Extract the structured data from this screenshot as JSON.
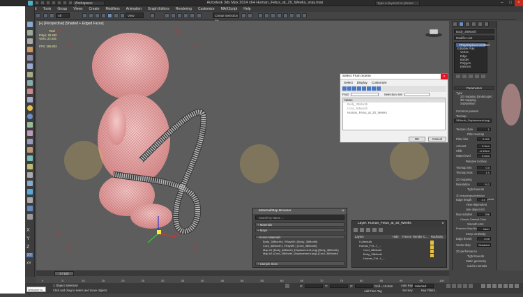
{
  "window": {
    "title": "Autodesk 3ds Max 2014 x64   Human_Fetus_at_20_Weeks_vray.max",
    "workspace": "Workspace: Default",
    "search_placeholder": "Type a keyword or phrase"
  },
  "menu": [
    "Edit",
    "Tools",
    "Group",
    "Views",
    "Create",
    "Modifiers",
    "Animation",
    "Graph Editors",
    "Rendering",
    "Customize",
    "MAXScript",
    "Help"
  ],
  "toolbar": {
    "filter": "All",
    "selection_set": "View",
    "named_sel": "Create Selection Se"
  },
  "viewport": {
    "label": "[+] [Perspective] [Shaded + Edged Faces]",
    "stats_title": "Total",
    "polys_label": "Polys:",
    "polys_value": "25 882",
    "verts_label": "Verts:",
    "verts_value": "23 545",
    "fps_label": "FPS:",
    "fps_value": "369.803"
  },
  "command_panel": {
    "object_name": "Body_38Month",
    "modifier_list": "Modifier List",
    "stack": [
      {
        "label": "VRayDisplacementMod",
        "selected": true
      },
      {
        "label": "Editable Poly",
        "selected": false
      },
      {
        "label": "Vertex",
        "selected": false
      },
      {
        "label": "Edge",
        "selected": false
      },
      {
        "label": "Border",
        "selected": false
      },
      {
        "label": "Polygon",
        "selected": false
      },
      {
        "label": "Element",
        "selected": false
      }
    ],
    "params_title": "Parameters",
    "type_label": "Type",
    "opts": [
      "2D mapping (landscape)",
      "3D mapping",
      "Subdivision"
    ],
    "common_title": "Common params",
    "texmap_label": "Texmap",
    "texmap_value": "38Month_Displacement.png)",
    "rows": [
      {
        "label": "Texture chan",
        "value": "1"
      },
      {
        "label": "Filter texmap",
        "value": ""
      },
      {
        "label": "Filter blur",
        "value": "0.001"
      },
      {
        "label": "Amount",
        "value": "0.3cm"
      },
      {
        "label": "Shift",
        "value": "-0.15cm"
      },
      {
        "label": "Water level",
        "value": "0.0cm"
      }
    ],
    "relative_bbox": "Relative to bbox",
    "texmap_min": {
      "label": "Texmap min",
      "value": "0.0"
    },
    "texmap_max": {
      "label": "Texmap max",
      "value": "1.0"
    },
    "mapping_title": "2D mapping",
    "resolution": {
      "label": "Resolution",
      "value": "512"
    },
    "tight_bounds": "Tight bounds",
    "mapping3d_title": "3D mapping/subdivision",
    "edge_length": {
      "label": "Edge length",
      "value": "4.0",
      "unit": "pixels"
    },
    "view_dependent": "View-dependent",
    "use_object_mtl": "Use object mtl",
    "max_subdivs": {
      "label": "Max subdivs",
      "value": "256"
    },
    "classic_catmull": "Classic Catmull-Clark",
    "smooth_uvs": "Smooth UVs",
    "preserve_map": {
      "label": "Preserve Map Bnd",
      "value": "Interr"
    },
    "keep_continuity": "Keep continuity",
    "edge_thresh": {
      "label": "Edge thresh",
      "value": "0.05"
    },
    "vector_disp": {
      "label": "Vector disp",
      "value": "Disabled"
    },
    "perf_title": "3D performance",
    "tight_bounds2": "Tight bounds",
    "static_geometry": "Static geometry",
    "cache_normals": "Cache normals"
  },
  "select_dialog": {
    "title": "Select From Scene",
    "tabs": [
      "Select",
      "Display",
      "Customize"
    ],
    "find_label": "Find:",
    "selset_label": "Selection Set:",
    "name_header": "Name",
    "items": [
      "Body_38Month",
      "Cord_38Month",
      "Human_Fetus_at_20_Weeks"
    ],
    "ok": "OK",
    "cancel": "Cancel"
  },
  "material_browser": {
    "title": "Material/Map Browser",
    "search": "Search by Name ...",
    "materials": "+ Materials",
    "maps": "+ Maps",
    "scene_materials": "- Scene Materials",
    "entries": [
      "Body_38Month ( VRayMtl ) [Body_38Month]",
      "Cord_38Month ( VRayMtl ) [Cord_38Month]",
      "Map #1 (Body_38Month_Displacement.png) [Body_38Month]",
      "Map #2 (Cord_38Month_Displacement.png) [Cord_38Month]"
    ],
    "sample_slots": "+ Sample Slots"
  },
  "layer_explorer": {
    "title": "Layer: Human_Fetus_at_20_Weeks",
    "columns": [
      "Layers",
      "Hide",
      "Freeze",
      "Render",
      "C...",
      "Radiosity"
    ],
    "rows": [
      "0 (default)",
      "Human_Fet...f_...",
      "Cord_38Month",
      "Body_38Month",
      "Human_Fet...f_..."
    ]
  },
  "timeline": {
    "frame": "0 / 100",
    "ticks": [
      "0",
      "5",
      "10",
      "15",
      "20",
      "25",
      "30",
      "35",
      "40",
      "45",
      "50",
      "55",
      "60",
      "65",
      "70",
      "75",
      "80",
      "85",
      "90",
      "95",
      "100"
    ]
  },
  "status": {
    "maxscript": "Welcome to M",
    "selected": "1 Object Selected",
    "prompt": "Click and drag to select and move objects",
    "x": "X:",
    "y": "Y:",
    "z": "Z:",
    "grid": "Grid = 10.0cm",
    "autokey": "Auto Key",
    "selected_dd": "Selected",
    "setkey": "Set Key",
    "keyfilters": "Key Filters...",
    "add_time_tag": "Add Time Tag"
  },
  "axes": [
    "X",
    "Y",
    "Z",
    "XY",
    "XY"
  ]
}
